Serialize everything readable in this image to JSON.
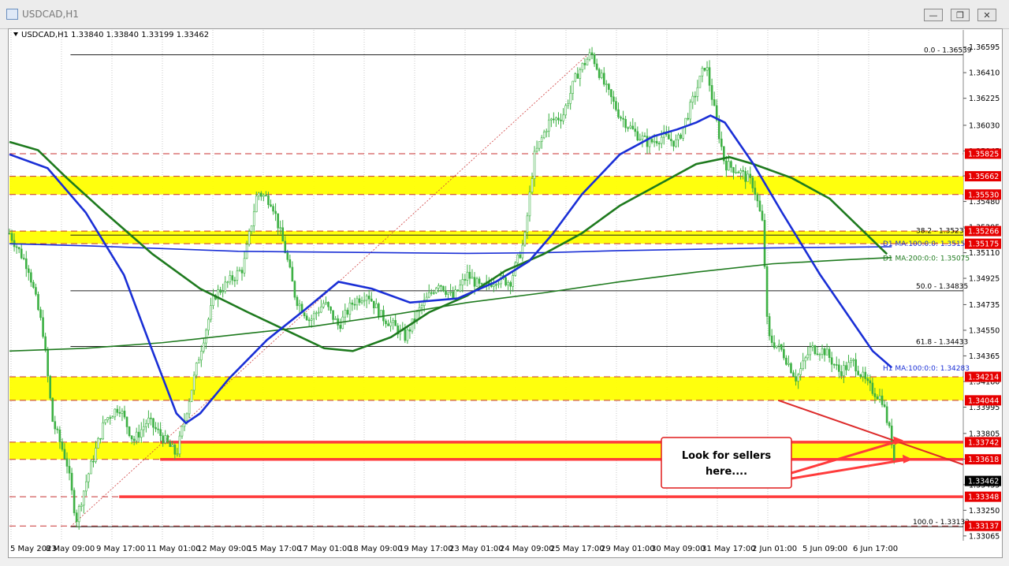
{
  "window": {
    "title": "USDCAD,H1"
  },
  "header": {
    "symbol_line": "USDCAD,H1  1.33840 1.33840 1.33199 1.33462"
  },
  "callout": {
    "line1": "Look for sellers",
    "line2": "here...."
  },
  "colors": {
    "zone": "#ffff00",
    "line_red": "#ff3b3b",
    "h1_ma100": "#1a2fd6",
    "h1_ma200": "#1e7a1e",
    "d1_ma100": "#1a2fd6",
    "d1_ma200": "#1e7a1e",
    "candle": "#3cb043",
    "price_label_bg": "#e60000",
    "current_label_bg": "#000000"
  },
  "chart_data": {
    "type": "candlestick",
    "instrument": "USDCAD",
    "timeframe": "H1",
    "ohlc_header": {
      "open": 1.3384,
      "high": 1.3384,
      "low": 1.33199,
      "close": 1.33462
    },
    "ylim": [
      1.3303,
      1.3665
    ],
    "y_ticks": [
      "1.36595",
      "1.36410",
      "1.36225",
      "1.36030",
      "1.35845",
      "1.35665",
      "1.35480",
      "1.35295",
      "1.35110",
      "1.34925",
      "1.34735",
      "1.34550",
      "1.34365",
      "1.34180",
      "1.33995",
      "1.33805",
      "1.33620",
      "1.33435",
      "1.33250",
      "1.33065"
    ],
    "x_ticks": [
      "5 May 2023",
      "8 May 09:00",
      "9 May 17:00",
      "11 May 01:00",
      "12 May 09:00",
      "15 May 17:00",
      "17 May 01:00",
      "18 May 09:00",
      "19 May 17:00",
      "23 May 01:00",
      "24 May 09:00",
      "25 May 17:00",
      "29 May 01:00",
      "30 May 09:00",
      "31 May 17:00",
      "2 Jun 01:00",
      "5 Jun 09:00",
      "6 Jun 17:00"
    ],
    "fib_levels": [
      {
        "label": "0.0 - 1.36539",
        "value": 1.36539
      },
      {
        "label": "38.2 - 1.35237",
        "value": 1.35237
      },
      {
        "label": "50.0 - 1.34835",
        "value": 1.34835
      },
      {
        "label": "61.8 - 1.34433",
        "value": 1.34433
      },
      {
        "label": "100.0 - 1.33132",
        "value": 1.33132
      }
    ],
    "ma_labels": [
      {
        "label": "D1 MA:100:0:0: 1.35153",
        "value": 1.35153
      },
      {
        "label": "D1 MA:200:0:0: 1.35075",
        "value": 1.35075
      },
      {
        "label": "H1 MA:100:0:0: 1.34283",
        "value": 1.34283
      }
    ],
    "price_labels": [
      {
        "label": "1.35825",
        "value": 1.35825
      },
      {
        "label": "1.35662",
        "value": 1.35662
      },
      {
        "label": "1.35530",
        "value": 1.3553
      },
      {
        "label": "1.35266",
        "value": 1.35266
      },
      {
        "label": "1.35175",
        "value": 1.35175
      },
      {
        "label": "1.34214",
        "value": 1.34214
      },
      {
        "label": "1.34044",
        "value": 1.34044
      },
      {
        "label": "1.33742",
        "value": 1.33742
      },
      {
        "label": "1.33618",
        "value": 1.33618
      },
      {
        "label": "1.33348",
        "value": 1.33348
      },
      {
        "label": "1.33137",
        "value": 1.33137
      }
    ],
    "current_price": {
      "label": "1.33462",
      "value": 1.33462
    },
    "zones": [
      {
        "from": 1.3553,
        "to": 1.35662
      },
      {
        "from": 1.35175,
        "to": 1.35266
      },
      {
        "from": 1.34044,
        "to": 1.34214
      },
      {
        "from": 1.33618,
        "to": 1.33742
      }
    ],
    "h1_ma100": [
      [
        0.0,
        1.3582
      ],
      [
        0.04,
        1.3572
      ],
      [
        0.08,
        1.354
      ],
      [
        0.12,
        1.3495
      ],
      [
        0.15,
        1.344
      ],
      [
        0.175,
        1.3395
      ],
      [
        0.185,
        1.3388
      ],
      [
        0.2,
        1.3395
      ],
      [
        0.23,
        1.342
      ],
      [
        0.27,
        1.3448
      ],
      [
        0.31,
        1.347
      ],
      [
        0.345,
        1.349
      ],
      [
        0.38,
        1.3485
      ],
      [
        0.42,
        1.3475
      ],
      [
        0.47,
        1.3478
      ],
      [
        0.51,
        1.349
      ],
      [
        0.545,
        1.3505
      ],
      [
        0.57,
        1.3525
      ],
      [
        0.6,
        1.3553
      ],
      [
        0.64,
        1.3582
      ],
      [
        0.675,
        1.3595
      ],
      [
        0.7,
        1.36
      ],
      [
        0.72,
        1.3605
      ],
      [
        0.735,
        1.361
      ],
      [
        0.75,
        1.3605
      ],
      [
        0.78,
        1.3575
      ],
      [
        0.81,
        1.354
      ],
      [
        0.85,
        1.3495
      ],
      [
        0.88,
        1.3465
      ],
      [
        0.905,
        1.344
      ],
      [
        0.925,
        1.3428
      ]
    ],
    "h1_ma200": [
      [
        0.0,
        1.3591
      ],
      [
        0.03,
        1.3585
      ],
      [
        0.06,
        1.3565
      ],
      [
        0.1,
        1.354
      ],
      [
        0.15,
        1.351
      ],
      [
        0.2,
        1.3485
      ],
      [
        0.25,
        1.3468
      ],
      [
        0.29,
        1.3455
      ],
      [
        0.33,
        1.3442
      ],
      [
        0.36,
        1.344
      ],
      [
        0.4,
        1.345
      ],
      [
        0.44,
        1.3468
      ],
      [
        0.48,
        1.348
      ],
      [
        0.52,
        1.3498
      ],
      [
        0.56,
        1.351
      ],
      [
        0.6,
        1.3525
      ],
      [
        0.64,
        1.3545
      ],
      [
        0.68,
        1.356
      ],
      [
        0.72,
        1.3575
      ],
      [
        0.755,
        1.358
      ],
      [
        0.78,
        1.3575
      ],
      [
        0.82,
        1.3565
      ],
      [
        0.86,
        1.355
      ],
      [
        0.89,
        1.353
      ],
      [
        0.92,
        1.351
      ]
    ],
    "d1_ma100": [
      [
        0.0,
        1.35175
      ],
      [
        0.08,
        1.3516
      ],
      [
        0.16,
        1.3514
      ],
      [
        0.24,
        1.3512
      ],
      [
        0.32,
        1.35115
      ],
      [
        0.4,
        1.3511
      ],
      [
        0.48,
        1.35105
      ],
      [
        0.56,
        1.3511
      ],
      [
        0.64,
        1.35125
      ],
      [
        0.72,
        1.35135
      ],
      [
        0.8,
        1.35145
      ],
      [
        0.88,
        1.3515
      ],
      [
        0.925,
        1.35153
      ]
    ],
    "d1_ma200": [
      [
        0.0,
        1.344
      ],
      [
        0.08,
        1.3442
      ],
      [
        0.16,
        1.3446
      ],
      [
        0.24,
        1.3452
      ],
      [
        0.32,
        1.3458
      ],
      [
        0.4,
        1.3466
      ],
      [
        0.48,
        1.3475
      ],
      [
        0.56,
        1.3482
      ],
      [
        0.64,
        1.349
      ],
      [
        0.72,
        1.3497
      ],
      [
        0.8,
        1.3503
      ],
      [
        0.88,
        1.3506
      ],
      [
        0.925,
        1.35075
      ]
    ],
    "close_path": [
      [
        0.0,
        1.3525
      ],
      [
        0.02,
        1.35
      ],
      [
        0.035,
        1.3455
      ],
      [
        0.045,
        1.339
      ],
      [
        0.06,
        1.336
      ],
      [
        0.07,
        1.3318
      ],
      [
        0.08,
        1.3345
      ],
      [
        0.1,
        1.339
      ],
      [
        0.115,
        1.34
      ],
      [
        0.13,
        1.3375
      ],
      [
        0.145,
        1.339
      ],
      [
        0.16,
        1.3378
      ],
      [
        0.175,
        1.3365
      ],
      [
        0.185,
        1.3395
      ],
      [
        0.2,
        1.344
      ],
      [
        0.215,
        1.348
      ],
      [
        0.23,
        1.349
      ],
      [
        0.245,
        1.35
      ],
      [
        0.26,
        1.3555
      ],
      [
        0.275,
        1.3548
      ],
      [
        0.29,
        1.351
      ],
      [
        0.3,
        1.3478
      ],
      [
        0.315,
        1.3462
      ],
      [
        0.33,
        1.3475
      ],
      [
        0.345,
        1.3458
      ],
      [
        0.36,
        1.3475
      ],
      [
        0.375,
        1.3482
      ],
      [
        0.39,
        1.3465
      ],
      [
        0.4,
        1.346
      ],
      [
        0.415,
        1.345
      ],
      [
        0.43,
        1.347
      ],
      [
        0.45,
        1.349
      ],
      [
        0.465,
        1.3478
      ],
      [
        0.48,
        1.3495
      ],
      [
        0.495,
        1.3485
      ],
      [
        0.51,
        1.3492
      ],
      [
        0.525,
        1.349
      ],
      [
        0.54,
        1.352
      ],
      [
        0.55,
        1.358
      ],
      [
        0.565,
        1.3605
      ],
      [
        0.58,
        1.361
      ],
      [
        0.595,
        1.364
      ],
      [
        0.61,
        1.3655
      ],
      [
        0.625,
        1.363
      ],
      [
        0.64,
        1.361
      ],
      [
        0.655,
        1.3598
      ],
      [
        0.67,
        1.359
      ],
      [
        0.685,
        1.3595
      ],
      [
        0.7,
        1.359
      ],
      [
        0.715,
        1.3618
      ],
      [
        0.73,
        1.3648
      ],
      [
        0.74,
        1.361
      ],
      [
        0.75,
        1.3575
      ],
      [
        0.765,
        1.357
      ],
      [
        0.78,
        1.356
      ],
      [
        0.79,
        1.353
      ],
      [
        0.795,
        1.345
      ],
      [
        0.81,
        1.344
      ],
      [
        0.825,
        1.342
      ],
      [
        0.84,
        1.3442
      ],
      [
        0.855,
        1.344
      ],
      [
        0.87,
        1.3425
      ],
      [
        0.885,
        1.3432
      ],
      [
        0.9,
        1.3415
      ],
      [
        0.915,
        1.3405
      ],
      [
        0.925,
        1.3375
      ],
      [
        0.93,
        1.3346
      ]
    ]
  }
}
